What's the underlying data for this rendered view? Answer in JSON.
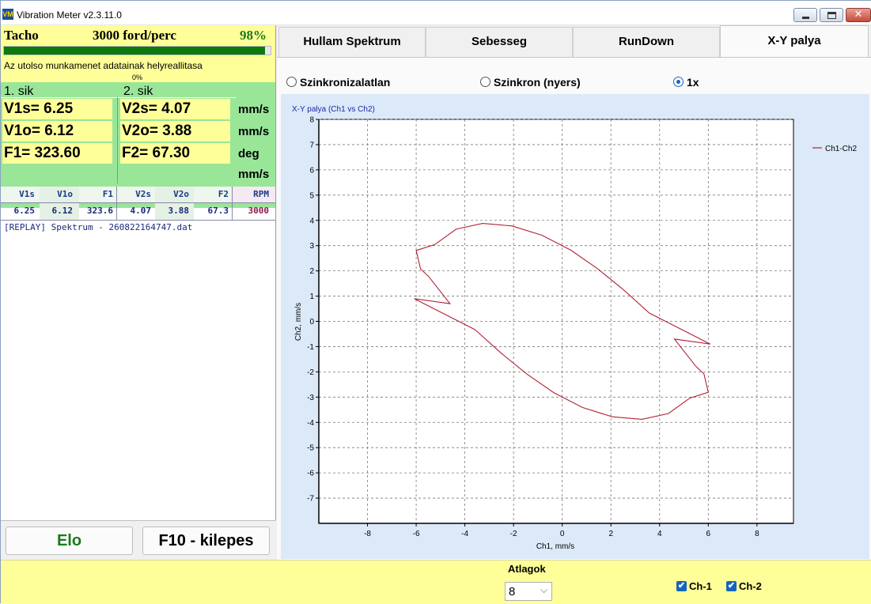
{
  "window": {
    "title": "Vibration Meter v2.3.11.0",
    "icon_text": "VM",
    "close_glyph": "✕"
  },
  "tacho": {
    "label": "Tacho",
    "value": "3000 ford/perc",
    "percent": "98%",
    "progress_fraction": 0.98
  },
  "status": {
    "text": "Az utolso munkamenet adatainak helyreallitasa",
    "percent": "0%"
  },
  "planes": {
    "plane1": {
      "title": "1. sik",
      "v_s": "V1s= 6.25",
      "v_o": "V1o= 6.12",
      "f": "F1= 323.60"
    },
    "plane2": {
      "title": "2. sik",
      "v_s": "V2s= 4.07",
      "v_o": "V2o= 3.88",
      "f": "F2= 67.30"
    },
    "units": [
      "mm/s",
      "mm/s",
      "deg",
      "mm/s"
    ]
  },
  "mini_table": {
    "headers": [
      "V1s",
      "V1o",
      "F1",
      "V2s",
      "V2o",
      "F2",
      "RPM"
    ],
    "values": [
      "6.25",
      "6.12",
      "323.6",
      "4.07",
      "3.88",
      "67.3",
      "3000"
    ]
  },
  "log": {
    "line": "[REPLAY] Spektrum - 260822164747.dat"
  },
  "buttons": {
    "elo": "Elo",
    "exit": "F10 - kilepes"
  },
  "tabs": [
    {
      "label": "Hullam Spektrum",
      "active": false
    },
    {
      "label": "Sebesseg",
      "active": false
    },
    {
      "label": "RunDown",
      "active": false
    },
    {
      "label": "X-Y palya",
      "active": true
    }
  ],
  "sync_mode": {
    "options": [
      "Szinkronizalatlan",
      "Szinkron (nyers)",
      "1x"
    ],
    "selected": "1x"
  },
  "bottom": {
    "averages_label": "Atlagok",
    "averages_value": "8",
    "chevron": "⌵",
    "ch1_label": "Ch-1",
    "ch1_checked": true,
    "ch2_label": "Ch-2",
    "ch2_checked": true,
    "check_glyph": "✔"
  },
  "colors": {
    "series": "#b22234",
    "tacho_percent": "#1a7a1a",
    "radio_selected": "#1565c0"
  },
  "chart_data": {
    "type": "line",
    "title": "X-Y palya (Ch1 vs Ch2)",
    "xlabel": "Ch1, mm/s",
    "ylabel": "Ch2, mm/s",
    "xlim": [
      -10,
      9.5
    ],
    "ylim": [
      -8,
      8
    ],
    "xticks": [
      -8,
      -6,
      -4,
      -2,
      0,
      2,
      4,
      6,
      8
    ],
    "yticks": [
      -7,
      -6,
      -5,
      -4,
      -3,
      -2,
      -1,
      0,
      1,
      2,
      3,
      4,
      5,
      6,
      7,
      8
    ],
    "grid": true,
    "legend_position": "top-right",
    "series": [
      {
        "name": "Ch1-Ch2",
        "color": "#b22234",
        "x": [
          -6.08,
          -5.82,
          -5.24,
          -4.36,
          -3.27,
          -2.06,
          -0.83,
          0.35,
          1.45,
          2.51,
          3.58,
          4.61,
          5.49,
          6.0,
          6.08,
          5.82,
          5.24,
          4.36,
          3.27,
          2.06,
          0.83,
          -0.35,
          -1.45,
          -2.51,
          -3.58,
          -4.61,
          -5.49,
          -6.0,
          -6.08
        ],
        "y": [
          0.9,
          2.08,
          3.04,
          3.65,
          3.88,
          3.78,
          3.41,
          2.82,
          2.09,
          1.26,
          0.33,
          -0.7,
          -1.78,
          -2.81,
          -0.9,
          -2.08,
          -3.04,
          -3.65,
          -3.88,
          -3.78,
          -3.41,
          -2.82,
          -2.09,
          -1.26,
          -0.33,
          0.7,
          1.78,
          2.81,
          0.9
        ]
      }
    ]
  }
}
